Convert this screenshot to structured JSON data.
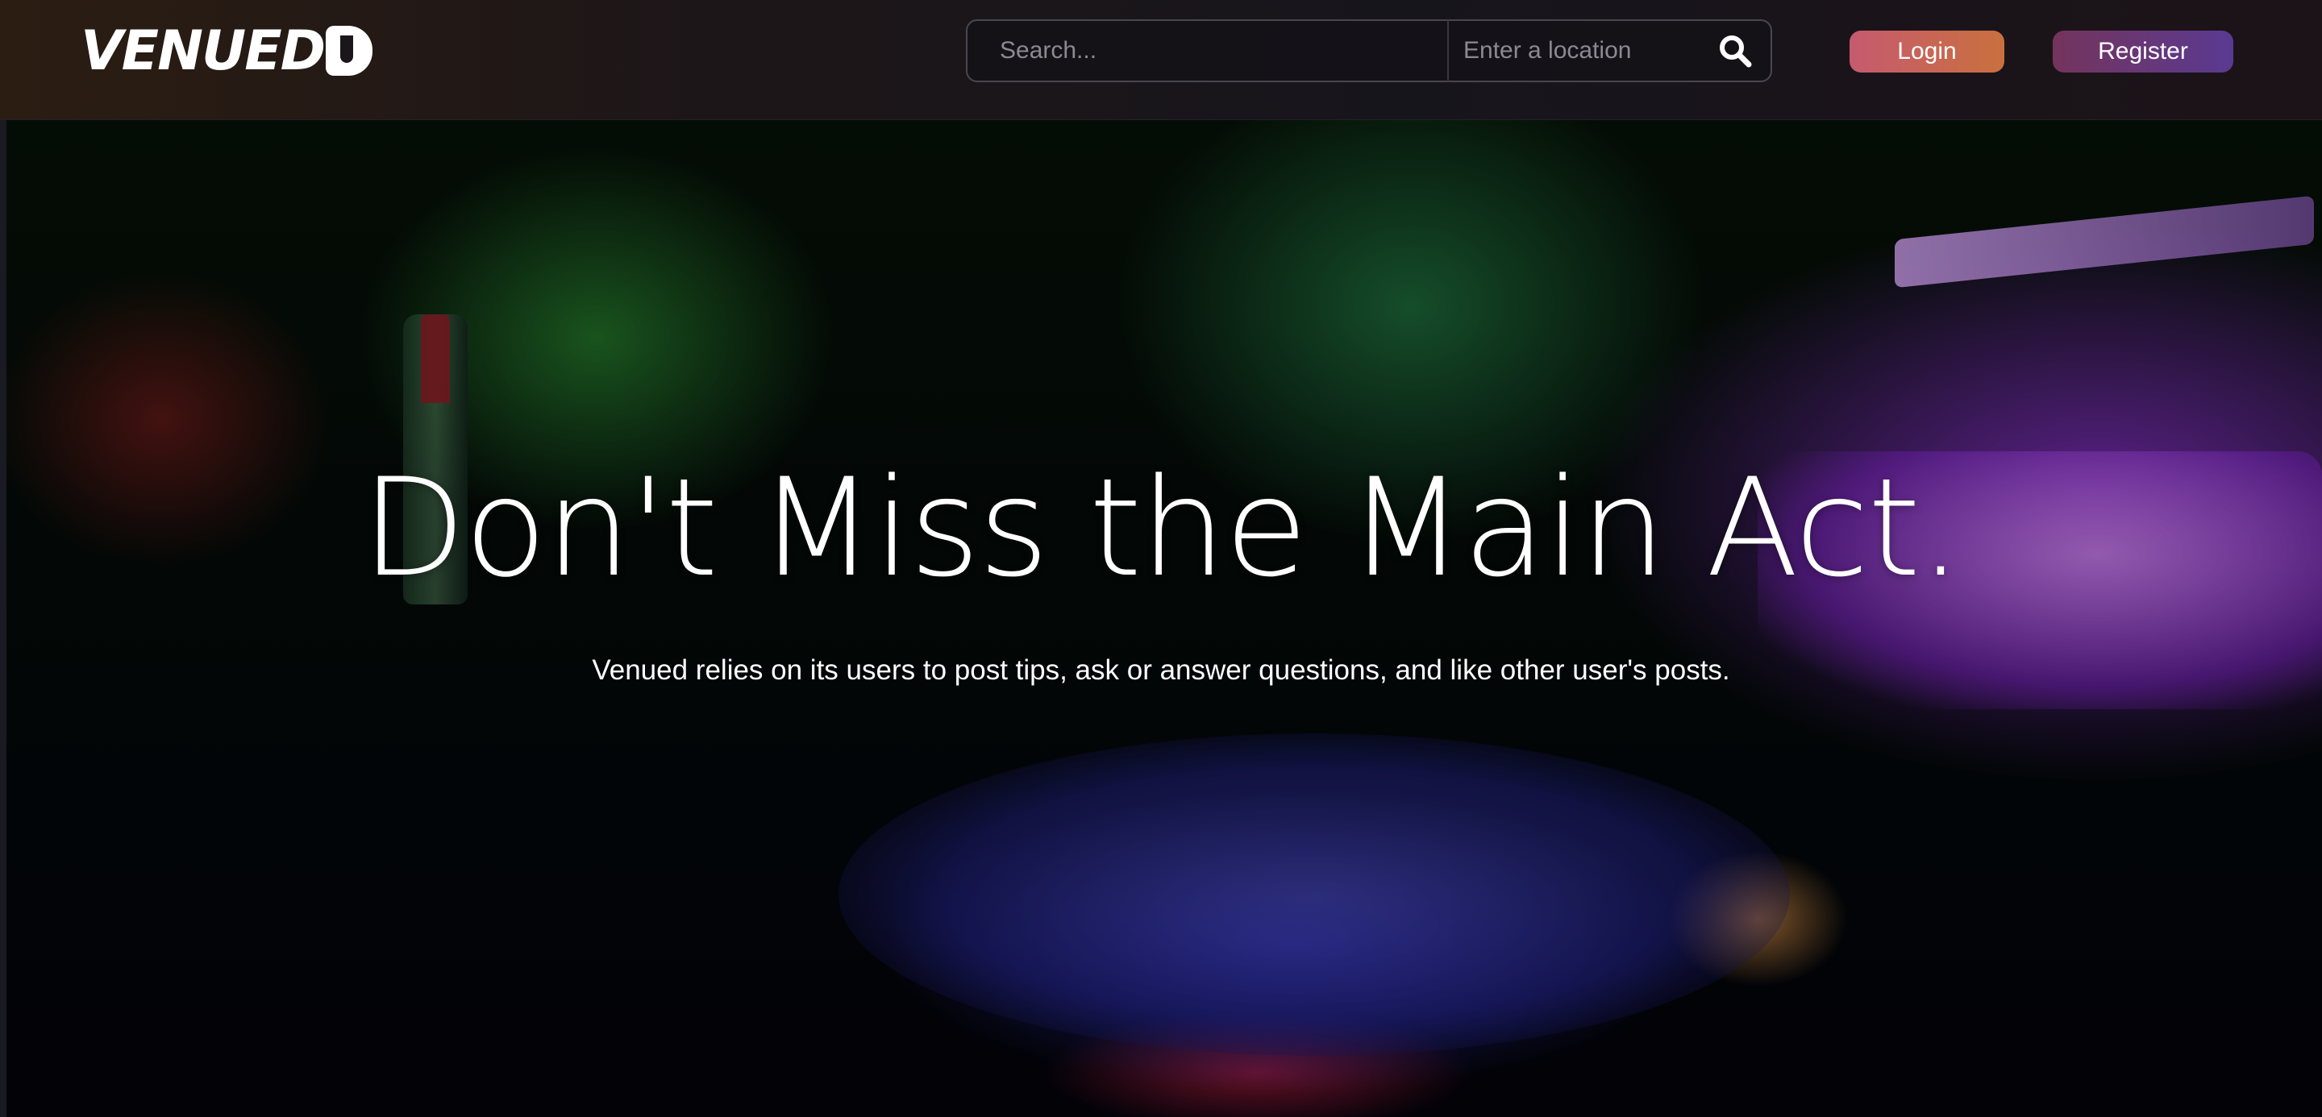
{
  "app": {
    "name": "Venued"
  },
  "header": {
    "logo_text": "VENUED",
    "logo_icon": "music-note-icon",
    "search": {
      "placeholder": "Search...",
      "location_placeholder": "Enter a location",
      "button_icon": "search-icon"
    },
    "login_label": "Login",
    "register_label": "Register"
  },
  "hero": {
    "title": "Don't Miss the Main Act.",
    "subtitle": "Venued relies on its users to post tips, ask or answer questions, and like other user's posts."
  },
  "colors": {
    "login_gradient_start": "#c65a6f",
    "login_gradient_end": "#c9703e",
    "register_gradient_start": "#74345c",
    "register_gradient_end": "#5a3a92",
    "header_bg": "#1d1618"
  }
}
